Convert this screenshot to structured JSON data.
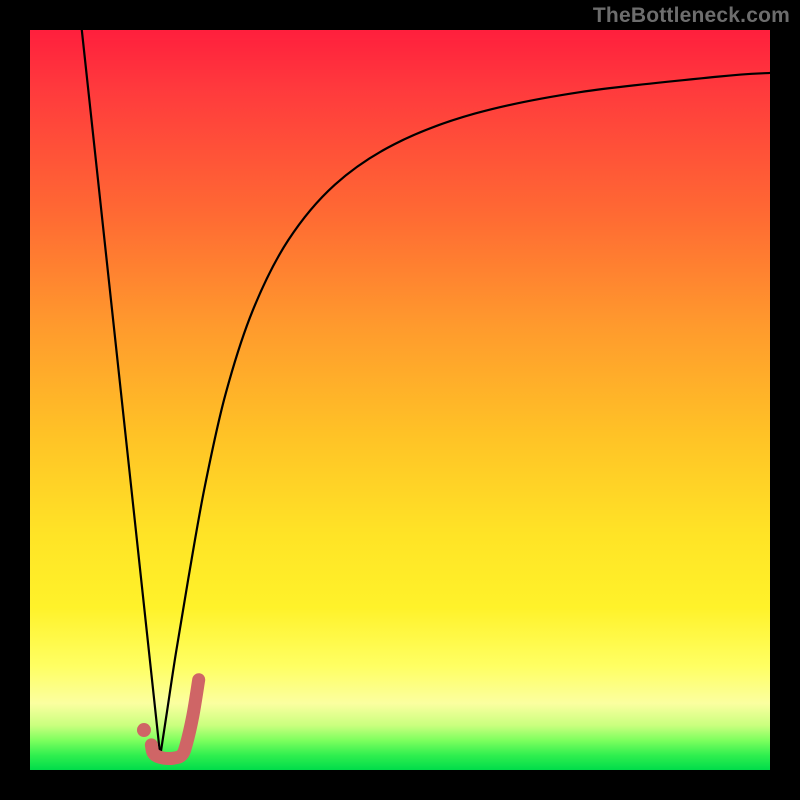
{
  "watermark": "TheBottleneck.com",
  "colors": {
    "frame": "#000000",
    "gradient_top": "#ff1f3d",
    "gradient_mid": "#ffe326",
    "gradient_bottom": "#00dc4a",
    "curve_stroke": "#000000",
    "marker_stroke": "#cf6566",
    "marker_dot": "#cf6566"
  },
  "chart_data": {
    "type": "line",
    "title": "",
    "xlabel": "",
    "ylabel": "",
    "xlim": [
      0,
      100
    ],
    "ylim": [
      0,
      100
    ],
    "grid": false,
    "legend": false,
    "series": [
      {
        "name": "left-segment",
        "x": [
          7.0,
          17.6
        ],
        "y": [
          100.0,
          1.9
        ]
      },
      {
        "name": "right-segment",
        "x": [
          17.6,
          18.5,
          19.7,
          21.4,
          23.6,
          26.4,
          30.1,
          34.9,
          41.2,
          49.3,
          60.1,
          74.3,
          93.0,
          100.0
        ],
        "y": [
          1.9,
          7.8,
          15.7,
          25.9,
          38.2,
          50.7,
          62.1,
          71.6,
          79.1,
          84.6,
          88.7,
          91.6,
          93.7,
          94.2
        ]
      }
    ],
    "marker": {
      "name": "j-marker",
      "dot": {
        "x": 15.4,
        "y": 5.4
      },
      "hook_path": [
        {
          "x": 16.4,
          "y": 3.4
        },
        {
          "x": 16.6,
          "y": 2.4
        },
        {
          "x": 17.1,
          "y": 1.9
        },
        {
          "x": 18.1,
          "y": 1.6
        },
        {
          "x": 19.4,
          "y": 1.6
        },
        {
          "x": 20.5,
          "y": 2.0
        },
        {
          "x": 21.1,
          "y": 3.4
        },
        {
          "x": 22.0,
          "y": 7.3
        },
        {
          "x": 22.8,
          "y": 12.2
        }
      ]
    }
  }
}
